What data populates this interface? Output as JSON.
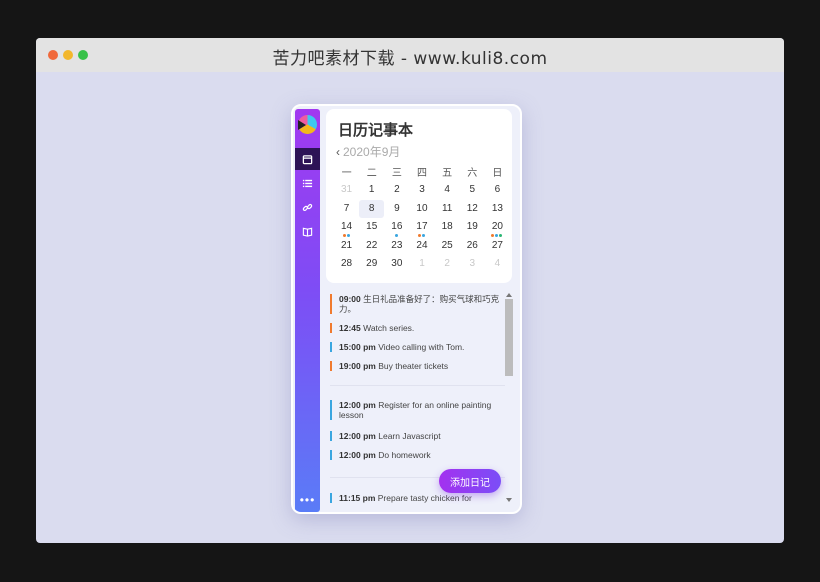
{
  "browser": {
    "title": "苦力吧素材下载 - www.kuli8.com"
  },
  "sidebar": {
    "items": [
      {
        "icon": "calendar-icon",
        "active": true
      },
      {
        "icon": "list-icon",
        "active": false
      },
      {
        "icon": "link-icon",
        "active": false
      },
      {
        "icon": "book-icon",
        "active": false
      }
    ],
    "more_label": "•••"
  },
  "calendar": {
    "title": "日历记事本",
    "prev_symbol": "‹",
    "month_label": "2020年9月",
    "weekdays": [
      "一",
      "二",
      "三",
      "四",
      "五",
      "六",
      "日"
    ],
    "days": [
      {
        "d": "31",
        "muted": true
      },
      {
        "d": "1"
      },
      {
        "d": "2"
      },
      {
        "d": "3"
      },
      {
        "d": "4"
      },
      {
        "d": "5"
      },
      {
        "d": "6"
      },
      {
        "d": "7"
      },
      {
        "d": "8",
        "selected": true
      },
      {
        "d": "9"
      },
      {
        "d": "10"
      },
      {
        "d": "11"
      },
      {
        "d": "12"
      },
      {
        "d": "13"
      },
      {
        "d": "14",
        "markers": [
          "#f07a2e",
          "#3aa6e0"
        ]
      },
      {
        "d": "15"
      },
      {
        "d": "16",
        "markers": [
          "#3aa6e0"
        ]
      },
      {
        "d": "17",
        "markers": [
          "#f07a2e",
          "#3aa6e0"
        ]
      },
      {
        "d": "18"
      },
      {
        "d": "19"
      },
      {
        "d": "20",
        "markers": [
          "#f07a2e",
          "#3aa6e0",
          "#2ab673"
        ]
      },
      {
        "d": "21"
      },
      {
        "d": "22"
      },
      {
        "d": "23"
      },
      {
        "d": "24"
      },
      {
        "d": "25"
      },
      {
        "d": "26"
      },
      {
        "d": "27"
      },
      {
        "d": "28"
      },
      {
        "d": "29"
      },
      {
        "d": "30"
      },
      {
        "d": "1",
        "muted": true
      },
      {
        "d": "2",
        "muted": true
      },
      {
        "d": "3",
        "muted": true
      },
      {
        "d": "4",
        "muted": true
      }
    ]
  },
  "events": [
    {
      "time": "09:00",
      "text": "生日礼品准备好了：购买气球和巧克力。",
      "color": "#f07a2e"
    },
    {
      "time": "12:45",
      "text": "Watch series.",
      "color": "#f07a2e"
    },
    {
      "time": "15:00 pm",
      "text": "Video calling with Tom.",
      "color": "#3aa6e0"
    },
    {
      "time": "19:00 pm",
      "text": "Buy theater tickets",
      "color": "#f07a2e"
    },
    {
      "time": "12:00 pm",
      "text": "Register for an online painting lesson",
      "color": "#3aa6e0"
    },
    {
      "time": "12:00 pm",
      "text": "Learn Javascript",
      "color": "#3aa6e0"
    },
    {
      "time": "12:00 pm",
      "text": "Do homework",
      "color": "#3aa6e0"
    },
    {
      "time": "11:15 pm",
      "text": "Prepare tasty chicken for",
      "color": "#3aa6e0"
    }
  ],
  "add_button": {
    "label": "添加日记"
  }
}
